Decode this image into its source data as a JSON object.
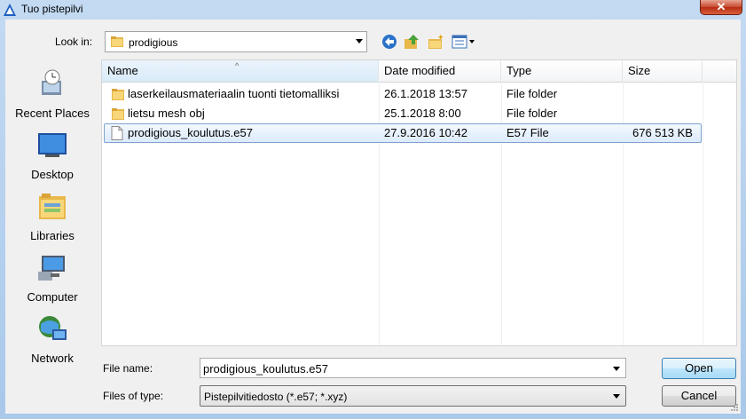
{
  "window": {
    "title": "Tuo pistepilvi",
    "close_label": "✕"
  },
  "toolbar": {
    "look_in_label": "Look in:",
    "look_in_value": "prodigious"
  },
  "places": [
    {
      "label": "Recent Places",
      "icon": "recent-places-icon"
    },
    {
      "label": "Desktop",
      "icon": "desktop-icon"
    },
    {
      "label": "Libraries",
      "icon": "libraries-icon"
    },
    {
      "label": "Computer",
      "icon": "computer-icon"
    },
    {
      "label": "Network",
      "icon": "network-icon"
    }
  ],
  "columns": [
    "Name",
    "Date modified",
    "Type",
    "Size"
  ],
  "files": [
    {
      "name": "laserkeilausmateriaalin tuonti tietomalliksi",
      "date": "26.1.2018 13:57",
      "type": "File folder",
      "size": "",
      "icon": "folder-icon"
    },
    {
      "name": "lietsu mesh obj",
      "date": "25.1.2018 8:00",
      "type": "File folder",
      "size": "",
      "icon": "folder-icon"
    },
    {
      "name": "prodigious_koulutus.e57",
      "date": "27.9.2016 10:42",
      "type": "E57 File",
      "size": "676 513 KB",
      "icon": "file-icon"
    }
  ],
  "bottom": {
    "file_name_label": "File name:",
    "file_name_value": "prodigious_koulutus.e57",
    "file_type_label": "Files of type:",
    "file_type_value": "Pistepilvitiedosto (*.e57; *.xyz)",
    "open_label": "Open",
    "cancel_label": "Cancel"
  }
}
